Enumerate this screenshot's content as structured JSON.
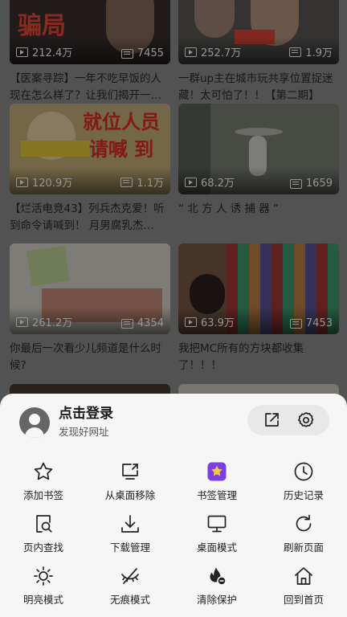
{
  "feed": {
    "cards": [
      {
        "views": "212.4万",
        "danmu": "7455",
        "title": "【医案寻踪】一年不吃早饭的人现在怎么样了？让我们揭开一…",
        "thumb_bg": "#3b3030",
        "overlay_text": "骗局"
      },
      {
        "views": "252.7万",
        "danmu": "1.9万",
        "title": "一群up主在城市玩共享位置捉迷藏！太可怕了！！【第二期】",
        "thumb_bg": "#5a5855",
        "overlay_text": ""
      },
      {
        "views": "120.9万",
        "danmu": "1.1万",
        "title": "【烂活电竞43】列兵杰克爱！听到命令请喊到！ 月男腐乳杰…",
        "thumb_bg": "#c9b27a",
        "overlay_text": "就位人员 请喊 到"
      },
      {
        "views": "68.2万",
        "danmu": "1659",
        "title": "“ 北 方 人 诱 捕 器 ”",
        "thumb_bg": "#7c8076",
        "overlay_text": ""
      },
      {
        "views": "261.2万",
        "danmu": "4354",
        "title": "你最后一次看少儿频道是什么时候?",
        "thumb_bg": "#d9d6cc",
        "overlay_text": ""
      },
      {
        "views": "63.9万",
        "danmu": "7453",
        "title": "我把MC所有的方块都收集了！！！",
        "thumb_bg": "#7a5a48",
        "overlay_text": ""
      }
    ]
  },
  "sheet": {
    "login_title": "点击登录",
    "login_subtitle": "发现好网址",
    "top_actions": [
      {
        "icon": "share-icon"
      },
      {
        "icon": "gear-icon"
      }
    ],
    "menu": [
      {
        "label": "添加书签",
        "icon": "star-icon"
      },
      {
        "label": "从桌面移除",
        "icon": "remove-from-desktop-icon"
      },
      {
        "label": "书签管理",
        "icon": "bookmark-manager-icon"
      },
      {
        "label": "历史记录",
        "icon": "history-clock-icon"
      },
      {
        "label": "页内查找",
        "icon": "find-in-page-icon"
      },
      {
        "label": "下载管理",
        "icon": "download-icon"
      },
      {
        "label": "桌面模式",
        "icon": "desktop-monitor-icon"
      },
      {
        "label": "刷新页面",
        "icon": "refresh-icon"
      },
      {
        "label": "明亮模式",
        "icon": "sun-icon"
      },
      {
        "label": "无痕模式",
        "icon": "incognito-eye-icon"
      },
      {
        "label": "清除保护",
        "icon": "clear-protect-icon"
      },
      {
        "label": "回到首页",
        "icon": "home-icon"
      }
    ]
  },
  "colors": {
    "sheet_bg": "#f6f6f6",
    "icon": "#222222",
    "badge_purple": "#7b3fe4",
    "badge_gold": "#f2c94c"
  }
}
